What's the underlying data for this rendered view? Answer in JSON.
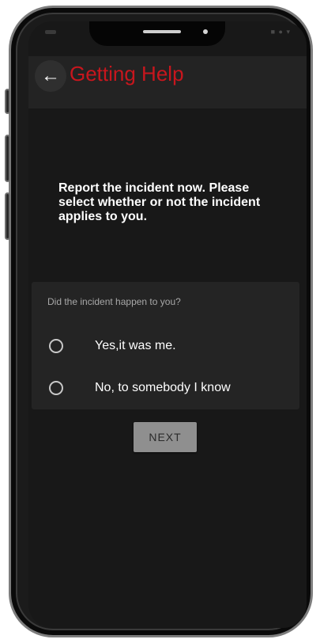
{
  "header": {
    "title": "Getting Help",
    "back_icon": "arrow-left-icon"
  },
  "main": {
    "prompt": "Report the incident now. Please select whether or not the incident applies to you.",
    "question": "Did the incident happen to you?",
    "options": [
      {
        "label": "Yes,it was me.",
        "selected": false
      },
      {
        "label": "No, to somebody I know",
        "selected": false
      }
    ],
    "next_label": "NEXT"
  },
  "colors": {
    "accent": "#c8161d",
    "background": "#181818",
    "card": "#242424",
    "button": "#8f8f8f"
  }
}
